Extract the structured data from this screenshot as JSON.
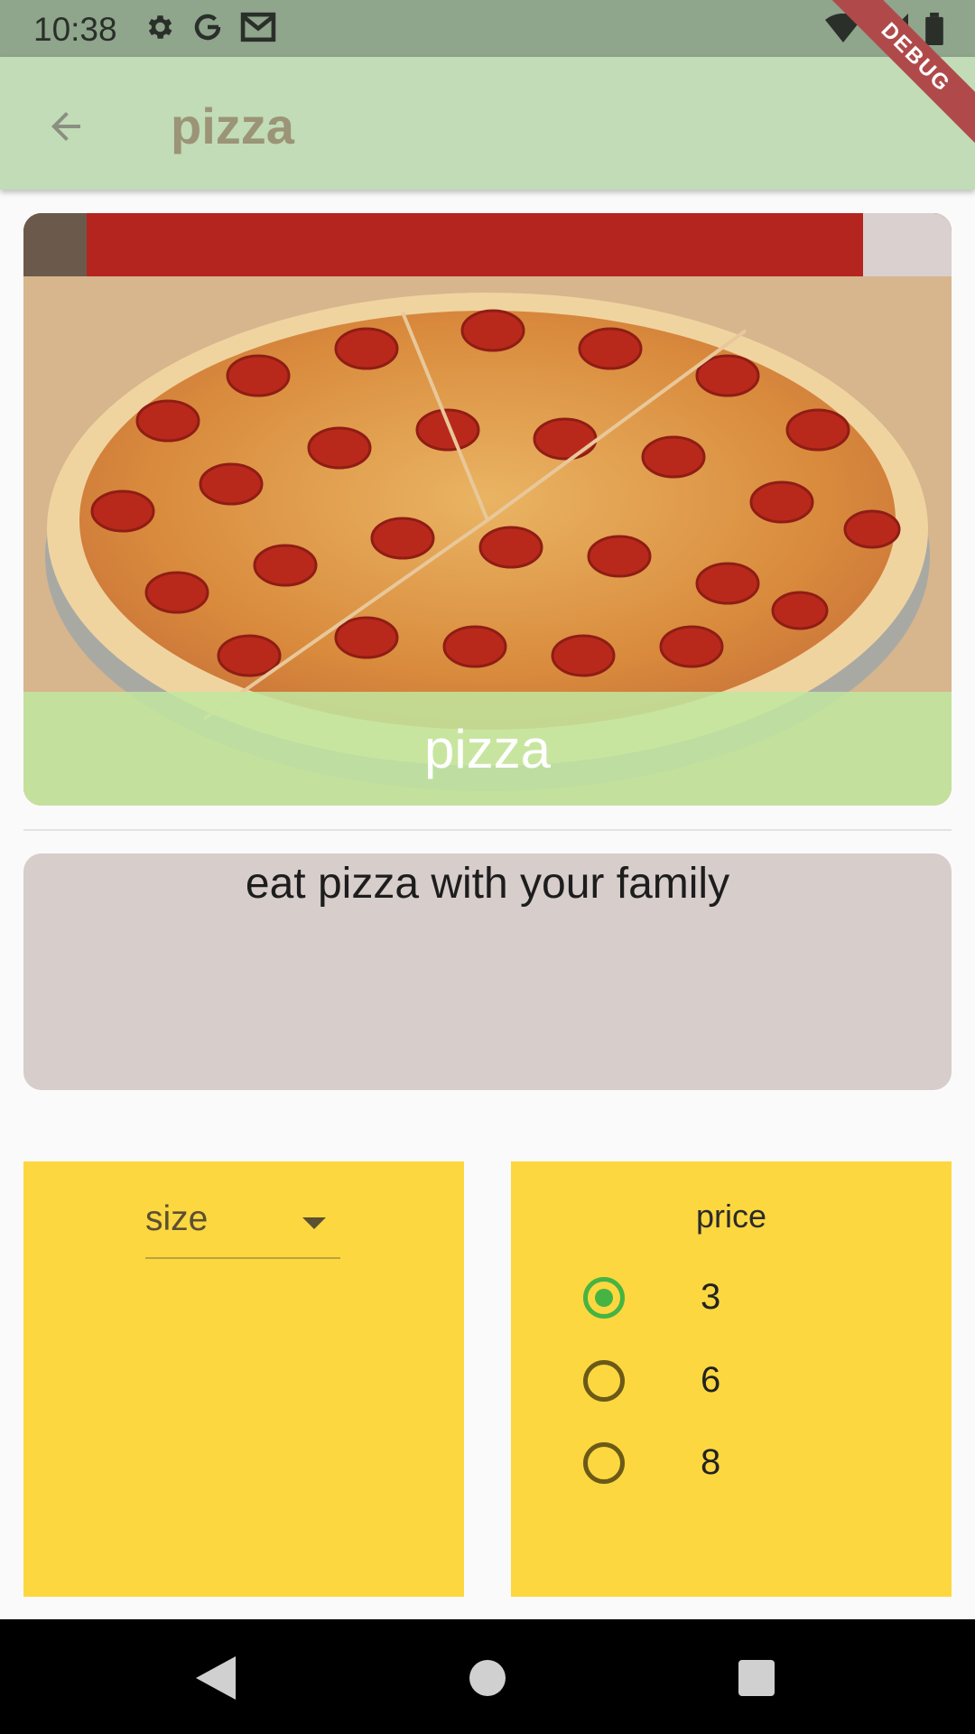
{
  "status_bar": {
    "time": "10:38",
    "left_icons": [
      "gear-icon",
      "google-g-icon",
      "gmail-icon"
    ],
    "right_icons": [
      "wifi-icon",
      "signal-icon",
      "battery-icon"
    ]
  },
  "debug_banner": {
    "label": "DEBUG"
  },
  "app_bar": {
    "title": "pizza",
    "back_icon": "arrow-back-icon"
  },
  "hero": {
    "caption": "pizza",
    "image_subject": "pepperoni pizza on a pan"
  },
  "description": {
    "text": "eat pizza with your family"
  },
  "size_panel": {
    "dropdown_placeholder": "size"
  },
  "price_panel": {
    "title": "price",
    "options": [
      {
        "label": "3",
        "selected": true
      },
      {
        "label": "6",
        "selected": false
      },
      {
        "label": "8",
        "selected": false
      }
    ]
  },
  "nav_bar": {
    "buttons": [
      "back-triangle-icon",
      "home-circle-icon",
      "recents-square-icon"
    ]
  },
  "colors": {
    "app_bar": "#c1dcb6",
    "status_bar": "#8fa58c",
    "caption_overlay": "#c1e8a0",
    "description_card": "#d7cdcb",
    "panel": "#fdd740",
    "radio_selected": "#45b443",
    "radio_unselected": "#6b5a17"
  }
}
